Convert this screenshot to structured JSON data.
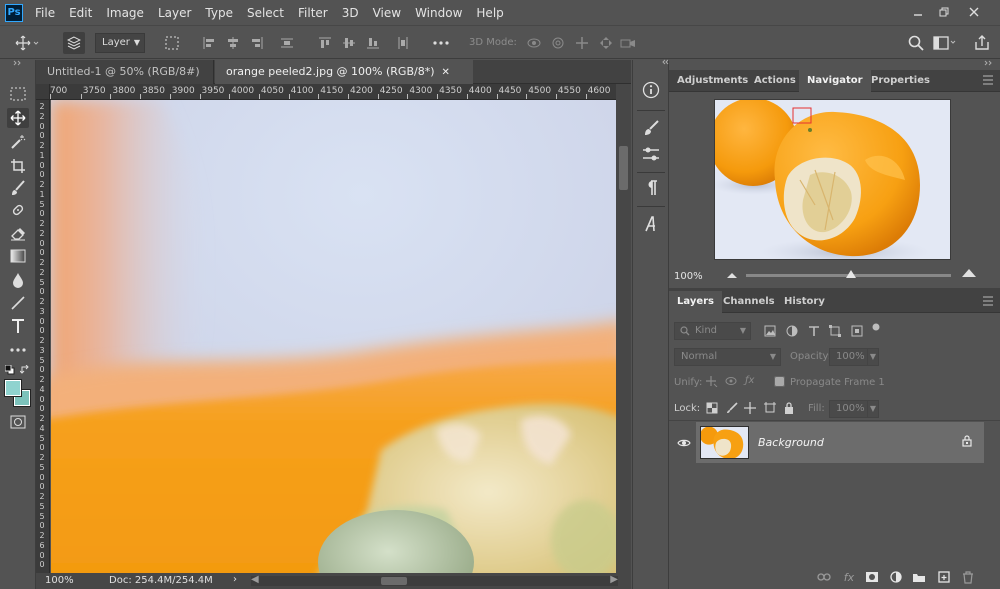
{
  "app": {
    "logo": "Ps",
    "menu": [
      "File",
      "Edit",
      "Image",
      "Layer",
      "Type",
      "Select",
      "Filter",
      "3D",
      "View",
      "Window",
      "Help"
    ]
  },
  "options_bar": {
    "layer_select": "Layer",
    "mode_3d_label": "3D Mode:"
  },
  "document_tabs": [
    {
      "label": "Untitled-1 @ 50% (RGB/8#) *",
      "active": false
    },
    {
      "label": "orange peeled2.jpg @ 100% (RGB/8*)",
      "active": true
    }
  ],
  "ruler": {
    "horizontal": [
      "700",
      "3750",
      "3800",
      "3850",
      "3900",
      "3950",
      "4000",
      "4050",
      "4100",
      "4150",
      "4200",
      "4250",
      "4300",
      "4350",
      "4400",
      "4450",
      "4500",
      "4550",
      "4600"
    ],
    "vertical": [
      "2",
      "2",
      "0",
      "0",
      "2",
      "1",
      "0",
      "0",
      "2",
      "1",
      "5",
      "0",
      "2",
      "2",
      "0",
      "0",
      "2",
      "2",
      "5",
      "0",
      "2",
      "3",
      "0",
      "0",
      "2",
      "3",
      "5",
      "0",
      "2",
      "4",
      "0",
      "0",
      "2",
      "4",
      "5",
      "0",
      "2",
      "5",
      "0",
      "0",
      "2",
      "5",
      "5",
      "0",
      "2",
      "6",
      "0",
      "0"
    ]
  },
  "status_bar": {
    "zoom": "100%",
    "doc": "Doc: 254.4M/254.4M",
    "arrow": "›"
  },
  "navigator_group": {
    "tabs": [
      "Adjustments",
      "Actions",
      "Navigator",
      "Properties"
    ],
    "active": "Navigator",
    "zoom": "100%"
  },
  "layers_group": {
    "tabs": [
      "Layers",
      "Channels",
      "History"
    ],
    "active": "Layers",
    "filter_kind": "Kind",
    "blend_mode": "Normal",
    "opacity_label": "Opacity:",
    "opacity_value": "100%",
    "unify_label": "Unify:",
    "propagate_label": "Propagate Frame 1",
    "lock_label": "Lock:",
    "fill_label": "Fill:",
    "fill_value": "100%",
    "layers": [
      {
        "name": "Background",
        "visible": true,
        "locked": true
      }
    ]
  },
  "colors": {
    "foreground": "#8fd3cf",
    "background": "#7cc2bb",
    "ui_bg": "#535353",
    "panel_tab_bg": "#424242"
  }
}
